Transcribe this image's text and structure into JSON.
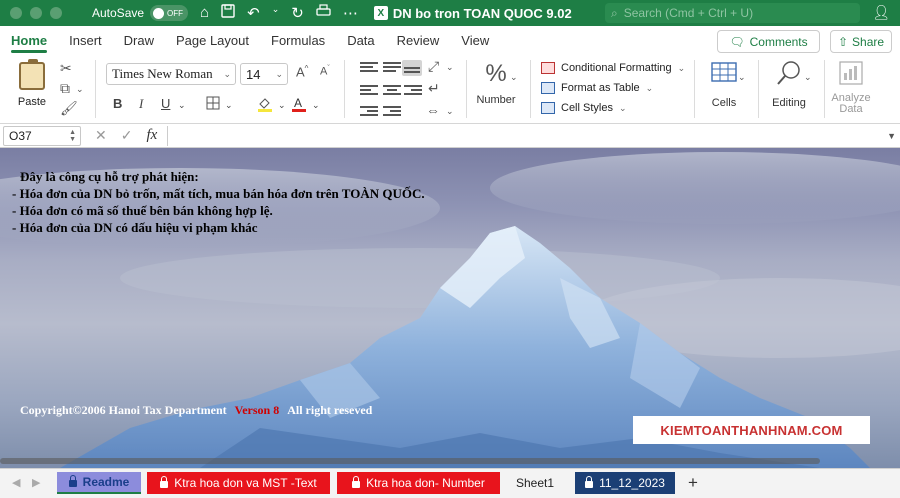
{
  "titlebar": {
    "autosave_label": "AutoSave",
    "autosave_state": "OFF",
    "document_title": "DN bo tron TOAN QUOC 9.02",
    "search_placeholder": "Search (Cmd + Ctrl + U)"
  },
  "ribbon_tabs": [
    "Home",
    "Insert",
    "Draw",
    "Page Layout",
    "Formulas",
    "Data",
    "Review",
    "View"
  ],
  "active_tab": "Home",
  "header_buttons": {
    "comments": "Comments",
    "share": "Share"
  },
  "ribbon": {
    "paste_label": "Paste",
    "font_name": "Times New Roman",
    "font_size": "14",
    "bold": "B",
    "italic": "I",
    "underline": "U",
    "number_label": "Number",
    "conditional_formatting": "Conditional Formatting",
    "format_as_table": "Format as Table",
    "cell_styles": "Cell Styles",
    "cells_label": "Cells",
    "editing_label": "Editing",
    "analyze_label_1": "Analyze",
    "analyze_label_2": "Data"
  },
  "formula_bar": {
    "name_box": "O37",
    "fx": "fx",
    "content": ""
  },
  "sheet": {
    "lines": [
      "Đây là công cụ hỗ trợ phát hiện:",
      "- Hóa đơn của DN bỏ trốn, mất tích, mua bán hóa đơn trên TOÀN QUỐC.",
      "- Hóa đơn có mã số thuế bên bán không hợp lệ.",
      "- Hóa đơn của DN có dấu hiệu vi phạm khác"
    ],
    "copyright_prefix": "Copyright©2006  Hanoi Tax Department",
    "version": "Verson 8",
    "copyright_suffix": "All right reseved",
    "brand": "KIEMTOANTHANHNAM.COM"
  },
  "sheet_tabs": [
    {
      "label": "Readme",
      "style": "readme",
      "locked": true
    },
    {
      "label": "Ktra hoa don va MST -Text",
      "style": "red",
      "locked": true
    },
    {
      "label": "Ktra hoa don- Number",
      "style": "red",
      "locked": true
    },
    {
      "label": "Sheet1",
      "style": "plain",
      "locked": false
    },
    {
      "label": "11_12_2023",
      "style": "navy",
      "locked": true
    }
  ],
  "colors": {
    "excel_green": "#1e7e45",
    "tab_red": "#e8141c",
    "tab_navy": "#1b3f75",
    "readme_tab": "#8c8cdc",
    "version_red": "#d00000",
    "brand_red": "#c83232"
  },
  "icons": [
    "home-icon",
    "save-icon",
    "undo-icon",
    "redo-icon",
    "print-icon",
    "search-icon",
    "person-icon",
    "cut-icon",
    "copy-icon",
    "format-painter-icon",
    "fill-color-icon",
    "font-color-icon",
    "borders-icon",
    "wrap-text-icon",
    "merge-icon",
    "percent-icon",
    "cells-table-icon",
    "magnifier-icon",
    "analyze-data-icon",
    "comment-icon",
    "share-icon"
  ]
}
